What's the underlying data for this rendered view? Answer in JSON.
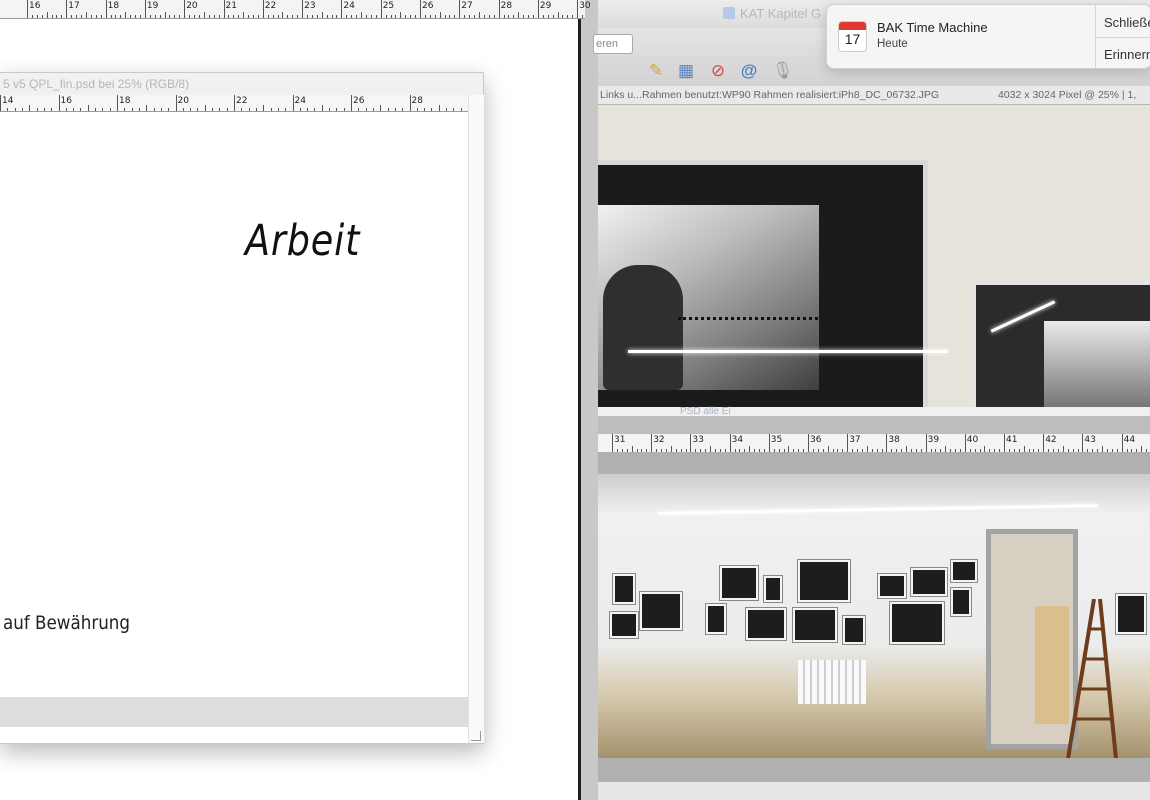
{
  "left_document": {
    "top_ruler_labels": [
      "16",
      "17",
      "18",
      "19",
      "20",
      "21",
      "22",
      "23",
      "24",
      "25",
      "26",
      "27",
      "28",
      "29",
      "30"
    ],
    "psd_window": {
      "title": "5 v5 QPL_fin.psd bei 25% (RGB/8)",
      "ruler_labels": [
        "14",
        "16",
        "18",
        "20",
        "22",
        "24",
        "26",
        "28"
      ],
      "heading_text": "Arbeit",
      "body_text": "auf Bewährung"
    }
  },
  "right_app": {
    "window_title": "KAT Kapitel G",
    "toolbar": {
      "search_field_text": "eren",
      "icons": [
        "pencil-icon",
        "layout-icon",
        "no-entry-icon",
        "at-sign-icon",
        "microphone-icon"
      ]
    },
    "status_bar": {
      "path": "Links u...Rahmen benutzt:WP90 Rahmen realisiert:iPh8_DC_06732.JPG",
      "info": "4032 x 3024 Pixel @ 25%  |  1,"
    },
    "folder_label": "PSD alle Ei",
    "ruler2_labels": [
      "31",
      "32",
      "33",
      "34",
      "35",
      "36",
      "37",
      "38",
      "39",
      "40",
      "41",
      "42",
      "43",
      "44"
    ]
  },
  "notification": {
    "icon_day": "17",
    "title": "BAK Time Machine",
    "subtitle": "Heute",
    "close_label": "Schließen",
    "remind_label": "Erinnern"
  }
}
